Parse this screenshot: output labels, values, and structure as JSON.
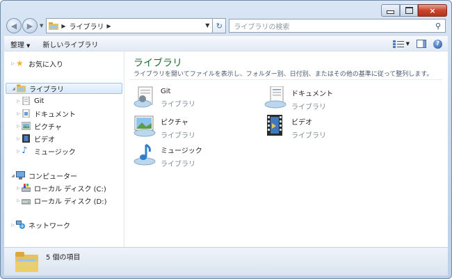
{
  "window": {
    "minimize_label": "",
    "maximize_label": "",
    "close_label": "×"
  },
  "address_bar": {
    "crumbs": [
      "ライブラリ"
    ],
    "search_placeholder": "ライブラリの検索"
  },
  "toolbar": {
    "organize_label": "整理",
    "new_library_label": "新しいライブラリ"
  },
  "sidebar": {
    "favorites": "お気に入り",
    "libraries": "ライブラリ",
    "library_items": [
      "Git",
      "ドキュメント",
      "ピクチャ",
      "ビデオ",
      "ミュージック"
    ],
    "computer": "コンピューター",
    "drives": [
      "ローカル ディスク (C:)",
      "ローカル ディスク (D:)"
    ],
    "network": "ネットワーク"
  },
  "main": {
    "title": "ライブラリ",
    "subtitle": "ライブラリを開いてファイルを表示し、フォルダー別、日付別、またはその他の基準に従って整列します。",
    "libraries": [
      {
        "name": "Git",
        "kind": "ライブラリ",
        "icon": "git-library-icon"
      },
      {
        "name": "ドキュメント",
        "kind": "ライブラリ",
        "icon": "documents-library-icon"
      },
      {
        "name": "ピクチャ",
        "kind": "ライブラリ",
        "icon": "pictures-library-icon"
      },
      {
        "name": "ビデオ",
        "kind": "ライブラリ",
        "icon": "videos-library-icon"
      },
      {
        "name": "ミュージック",
        "kind": "ライブラリ",
        "icon": "music-library-icon"
      }
    ]
  },
  "status_bar": {
    "item_count": "5 個の項目"
  },
  "colors": {
    "title_green": "#1d6b36",
    "selection_blue": "#d6e9fc",
    "chrome_blue": "#c8d9ed"
  }
}
